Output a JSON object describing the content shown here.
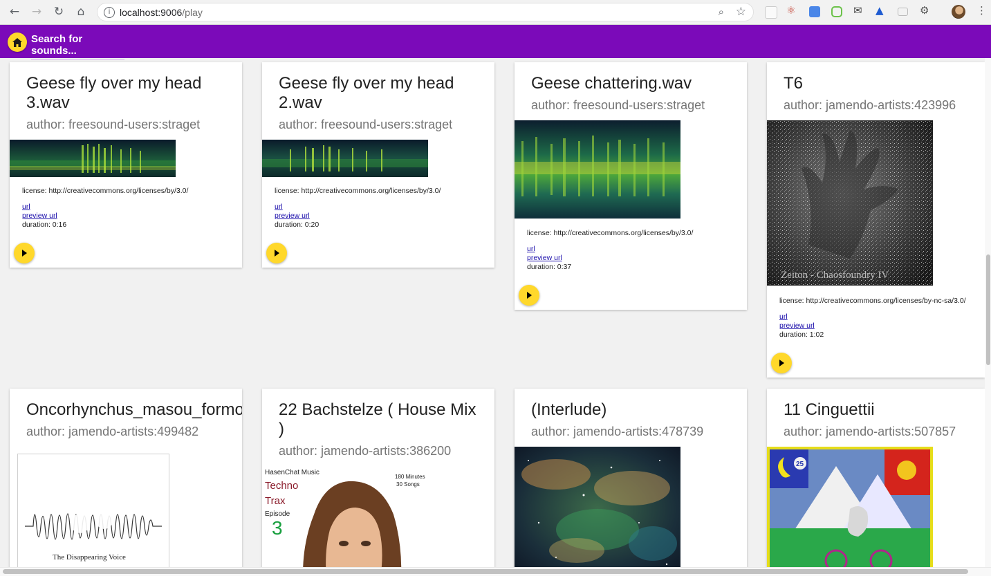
{
  "browser": {
    "url_host": "localhost:9006",
    "url_path": "/play"
  },
  "appbar": {
    "search_placeholder": "Search for sounds..."
  },
  "colors": {
    "appbar": "#7b0ab9",
    "accent": "#ffd82b"
  },
  "cards": [
    {
      "title": "Geese fly over my head 3.wav",
      "author": "author: freesound-users:straget",
      "license": "license: http://creativecommons.org/licenses/by/3.0/",
      "url_label": "url",
      "preview_label": "preview url",
      "duration": "duration: 0:16"
    },
    {
      "title": "Geese fly over my head 2.wav",
      "author": "author: freesound-users:straget",
      "license": "license: http://creativecommons.org/licenses/by/3.0/",
      "url_label": "url",
      "preview_label": "preview url",
      "duration": "duration: 0:20"
    },
    {
      "title": "Geese chattering.wav",
      "author": "author: freesound-users:straget",
      "license": "license: http://creativecommons.org/licenses/by/3.0/",
      "url_label": "url",
      "preview_label": "preview url",
      "duration": "duration: 0:37"
    },
    {
      "title": "T6",
      "author": "author: jamendo-artists:423996",
      "license": "license: http://creativecommons.org/licenses/by-nc-sa/3.0/",
      "url_label": "url",
      "preview_label": "preview url",
      "duration": "duration: 1:02",
      "image_text": "Zeiton - Chaosfoundry IV"
    },
    {
      "title": "Oncorhynchus_masou_formosanus",
      "author": "author: jamendo-artists:499482",
      "image_text": "The Disappearing Voice"
    },
    {
      "title": "22 Bachstelze ( House Mix )",
      "author": "author: jamendo-artists:386200",
      "cover": {
        "brand": "HasenChat Music",
        "line1": "Techno",
        "line2": "Trax",
        "episode_label": "Episode",
        "episode_num": "3",
        "minutes": "180 Minutes",
        "songs": "30 Songs"
      }
    },
    {
      "title": "(Interlude)",
      "author": "author: jamendo-artists:478739"
    },
    {
      "title": "11 Cinguettii",
      "author": "author: jamendo-artists:507857",
      "image_text": "25"
    }
  ]
}
